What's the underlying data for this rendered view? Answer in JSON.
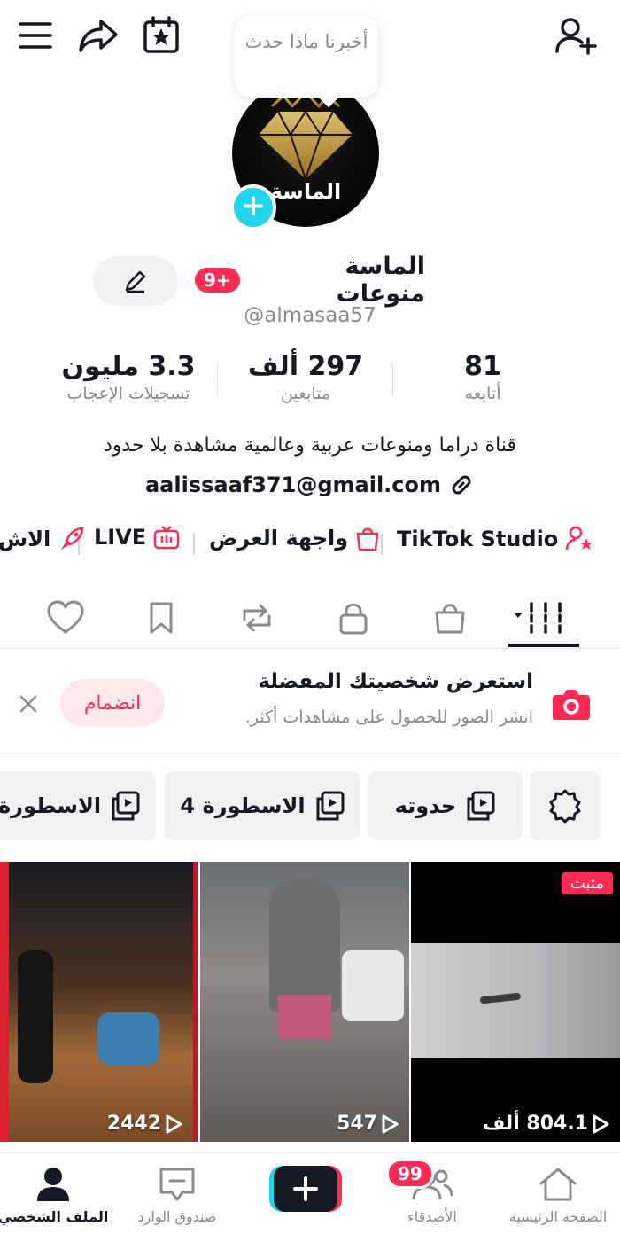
{
  "topbar": {
    "tooltip_text": "أخبرنا ماذا حدث",
    "icons": [
      "menu-icon",
      "share-icon",
      "calendar-star-icon",
      "add-friend-icon"
    ]
  },
  "profile": {
    "avatar_text": "الماسة",
    "name": "الماسة منوعات",
    "badge": "9+",
    "handle": "@almasaa57",
    "stats": [
      {
        "value": "81",
        "label": "أتابعه"
      },
      {
        "value": "297 ألف",
        "label": "متابعين"
      },
      {
        "value": "3.3 مليون",
        "label": "تسجيلات الإعجاب"
      }
    ],
    "bio": "قناة دراما ومنوعات عربية وعالمية مشاهدة بلا حدود",
    "link": "aalissaaf371@gmail.com"
  },
  "shortcuts": [
    {
      "label": "TikTok Studio",
      "icon": "creator-star-icon"
    },
    {
      "label": "واجهة العرض",
      "icon": "shopping-bag-icon"
    },
    {
      "label": "LIVE",
      "icon": "live-tv-icon"
    },
    {
      "label": "الاش",
      "icon": "promote-icon"
    }
  ],
  "tabs": [
    "videos-grid-icon",
    "shop-icon",
    "private-lock-icon",
    "repost-icon",
    "bookmark-icon",
    "liked-heart-icon"
  ],
  "promo": {
    "title": "استعرض شخصيتك المفضلة",
    "subtitle": "انشر الصور للحصول على مشاهدات أكثر.",
    "join_label": "انضمام"
  },
  "chips": [
    {
      "label": "حدوته"
    },
    {
      "label": "الاسطورة 4"
    },
    {
      "label": "الاسطورة"
    }
  ],
  "videos": [
    {
      "views": "804.1 ألف",
      "pinned": "مثبت"
    },
    {
      "views": "547"
    },
    {
      "views": "2442"
    }
  ],
  "nav": {
    "home": "الصفحة الرئيسية",
    "friends": "الأصدقاء",
    "friends_badge": "99",
    "inbox": "صندوق الوارد",
    "profile": "الملف الشخصي"
  },
  "colors": {
    "accent": "#fe2c55",
    "cyan": "#20d5ec"
  }
}
